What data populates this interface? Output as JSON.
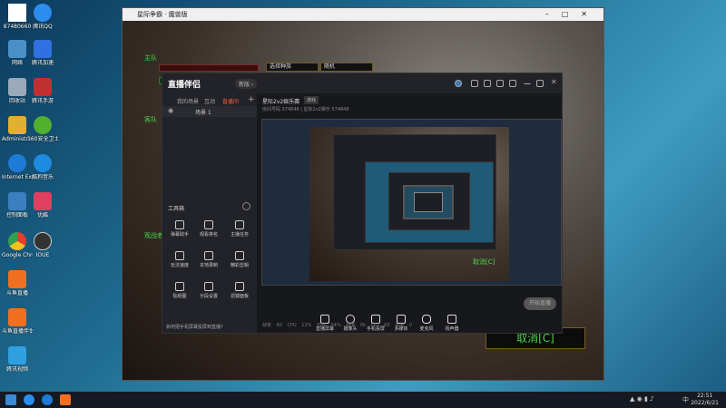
{
  "desktop": {
    "icons": [
      {
        "label": "87480660",
        "color": "#ffffff"
      },
      {
        "label": "腾讯QQ",
        "color": "#2d8cf0"
      },
      {
        "label": "网络",
        "color": "#4a90c8"
      },
      {
        "label": "腾讯加速",
        "color": "#3070e0"
      },
      {
        "label": "回收站",
        "color": "#9ab"
      },
      {
        "label": "腾讯手游",
        "color": "#c03030"
      },
      {
        "label": "Administr...",
        "color": "#e0b030"
      },
      {
        "label": "360安全卫士",
        "color": "#50b030"
      },
      {
        "label": "Internet Explorer",
        "color": "#1e7bd6"
      },
      {
        "label": "酷狗音乐",
        "color": "#1e8ae0"
      },
      {
        "label": "控制面板",
        "color": "#3a80c0"
      },
      {
        "label": "优酷",
        "color": "#e04060"
      },
      {
        "label": "Google Chrome",
        "color": "#e0a020"
      },
      {
        "label": "IOUE",
        "color": "#333"
      },
      {
        "label": "斗鱼直播",
        "color": "#f07020"
      },
      {
        "label": "斗鱼直播伴侣",
        "color": "#f07020"
      },
      {
        "label": "腾讯视频",
        "color": "#30a0e0"
      }
    ]
  },
  "game": {
    "title": "星际争霸 · 魔兽版",
    "team_label": "主队",
    "team2_label": "客队",
    "team3_label": "观战者",
    "race_select": "选择种族",
    "race_value": "随机",
    "cancel_label": "取消[C]"
  },
  "app": {
    "logo": "直播伴侣",
    "badge": "新版 ›",
    "sidebar_tabs": [
      "我的场景",
      "互动",
      "直播间"
    ],
    "scene_label": "场景 1",
    "tools_title": "工具箱",
    "tools": [
      {
        "label": "弹幕助手"
      },
      {
        "label": "观看排名"
      },
      {
        "label": "主播任务"
      },
      {
        "label": "玩法速度"
      },
      {
        "label": "本地录制"
      },
      {
        "label": "精彩剪辑"
      },
      {
        "label": "贴纸图"
      },
      {
        "label": "分段设置"
      },
      {
        "label": "滤镜面板"
      }
    ],
    "footer_tip": "如何把手机屏幕投屏到直播?",
    "room_title": "星际2v2娱乐赛",
    "room_tag": "游戏",
    "room_meta": "房间号码 574848 | 星际2v2娱乐 574848",
    "controls": [
      {
        "label": "直播屏幕"
      },
      {
        "label": "摄像头"
      },
      {
        "label": "手机投屏"
      },
      {
        "label": "多媒体"
      },
      {
        "label": "麦克风"
      },
      {
        "label": "扬声器"
      }
    ],
    "start_label": "开始直播",
    "stats": [
      "帧率 60",
      "CPU 12%",
      "内存 54%",
      "码率 0k",
      "FPS 60",
      "丢帧 0"
    ],
    "preview_cancel": "取消[C]"
  },
  "taskbar": {
    "time": "22:51",
    "date": "2022/6/21",
    "lang": "中"
  }
}
